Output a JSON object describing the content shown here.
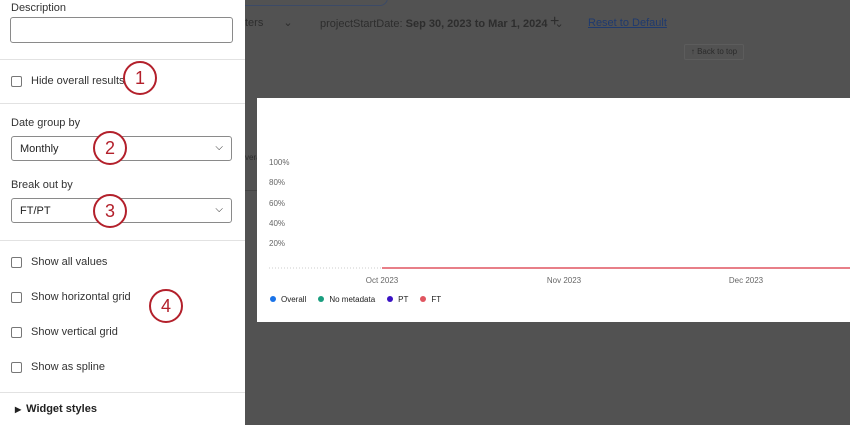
{
  "background": {
    "filters_fragment": "ters",
    "filter_label": "projectStartDate:",
    "filter_value": "Sep 30, 2023 to Mar 1, 2024",
    "reset_link": "Reset to Default",
    "back_to_top": "↑ Back to top",
    "overall_fragment": "vera"
  },
  "sidebar": {
    "description_label": "Description",
    "description_value": "",
    "hide_overall": "Hide overall results",
    "date_group_label": "Date group by",
    "date_group_value": "Monthly",
    "breakout_label": "Break out by",
    "breakout_value": "FT/PT",
    "options": [
      "Show all values",
      "Show horizontal grid",
      "Show vertical grid",
      "Show as spline"
    ],
    "widget_styles": "Widget styles"
  },
  "callouts": [
    "1",
    "2",
    "3",
    "4"
  ],
  "chart_data": {
    "type": "line",
    "y_ticks": [
      "100%",
      "80%",
      "60%",
      "40%",
      "20%"
    ],
    "ylim": [
      0,
      100
    ],
    "x_ticks": [
      "Oct 2023",
      "Nov 2023",
      "Dec 2023"
    ],
    "series": [
      {
        "name": "Overall",
        "color": "#1a73e8",
        "values": []
      },
      {
        "name": "No metadata",
        "color": "#1a9e7f",
        "values": []
      },
      {
        "name": "PT",
        "color": "#3a12c4",
        "values": []
      },
      {
        "name": "FT",
        "color": "#e05560",
        "values": [
          0,
          0,
          0
        ]
      }
    ]
  }
}
